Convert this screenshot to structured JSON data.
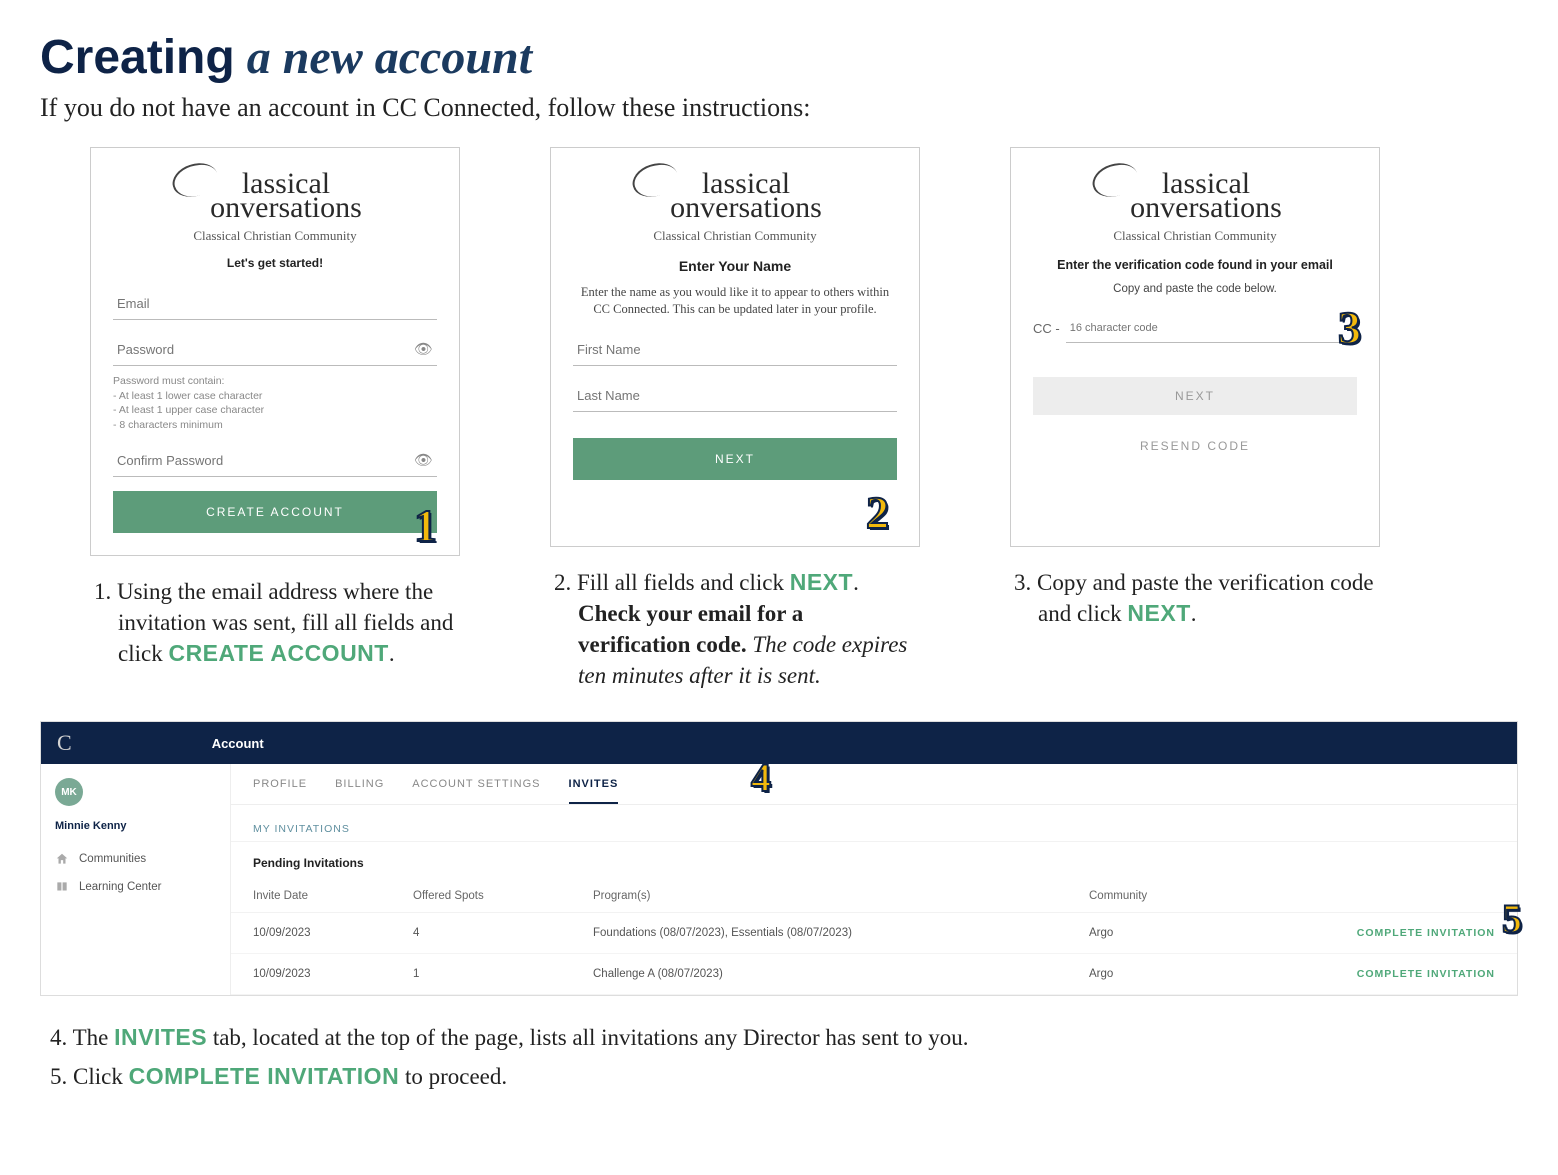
{
  "heading_bold": "Creating",
  "heading_italic": " a new account",
  "subheading": "If you do not have an account in CC Connected, follow these instructions:",
  "card1": {
    "logo_line1": "lassical",
    "logo_line2": "onversations",
    "logo_sub": "Classical Christian Community",
    "lets": "Let's get started!",
    "email_ph": "Email",
    "password_ph": "Password",
    "pw_head": "Password must contain:",
    "pw_r1": "- At least 1 lower case character",
    "pw_r2": "- At least 1 upper case character",
    "pw_r3": "- 8 characters minimum",
    "confirm_ph": "Confirm Password",
    "btn": "CREATE ACCOUNT",
    "badge": "1"
  },
  "card2": {
    "logo_sub": "Classical Christian Community",
    "heading": "Enter Your Name",
    "sub": "Enter the name as you would like it to appear to others within CC Connected. This can be updated later in your profile.",
    "first_ph": "First Name",
    "last_ph": "Last Name",
    "btn": "NEXT",
    "badge": "2"
  },
  "card3": {
    "logo_sub": "Classical Christian Community",
    "heading": "Enter the verification code found in your email",
    "sub": "Copy and paste the code below.",
    "prefix": "CC -",
    "code_ph": "16 character code",
    "btn_next": "NEXT",
    "btn_resend": "RESEND CODE",
    "badge": "3"
  },
  "caption1_num": "1. ",
  "caption1_a": "Using the email address where the invitation was sent, fill all fields and click ",
  "caption1_kw": "CREATE ACCOUNT",
  "caption1_b": ".",
  "caption2_num": "2. ",
  "caption2_a": "Fill all fields and click ",
  "caption2_kw": "NEXT",
  "caption2_b": ". ",
  "caption2_bold": "Check your email for a verification code.",
  "caption2_ital": " The code expires ten minutes after it is sent.",
  "caption3_num": "3. ",
  "caption3_a": "Copy and paste the verification code and click ",
  "caption3_kw": "NEXT",
  "caption3_b": ".",
  "dash": {
    "top_label": "Account",
    "avatar": "MK",
    "user": "Minnie Kenny",
    "side1": "Communities",
    "side2": "Learning Center",
    "tabs": [
      "PROFILE",
      "BILLING",
      "ACCOUNT SETTINGS",
      "INVITES"
    ],
    "section": "MY INVITATIONS",
    "subsection": "Pending Invitations",
    "cols": [
      "Invite Date",
      "Offered Spots",
      "Program(s)",
      "Community",
      ""
    ],
    "rows": [
      {
        "date": "10/09/2023",
        "spots": "4",
        "programs": "Foundations (08/07/2023), Essentials (08/07/2023)",
        "community": "Argo",
        "action": "COMPLETE INVITATION"
      },
      {
        "date": "10/09/2023",
        "spots": "1",
        "programs": "Challenge A (08/07/2023)",
        "community": "Argo",
        "action": "COMPLETE INVITATION"
      }
    ],
    "badge4": "4",
    "badge5": "5"
  },
  "bottom4_num": "4.   ",
  "bottom4_a": "The ",
  "bottom4_kw": "INVITES",
  "bottom4_b": " tab, located at the top of the page, lists all invitations any Director has sent to you.",
  "bottom5_num": "5.   ",
  "bottom5_a": "Click ",
  "bottom5_kw": "COMPLETE INVITATION",
  "bottom5_b": " to proceed."
}
